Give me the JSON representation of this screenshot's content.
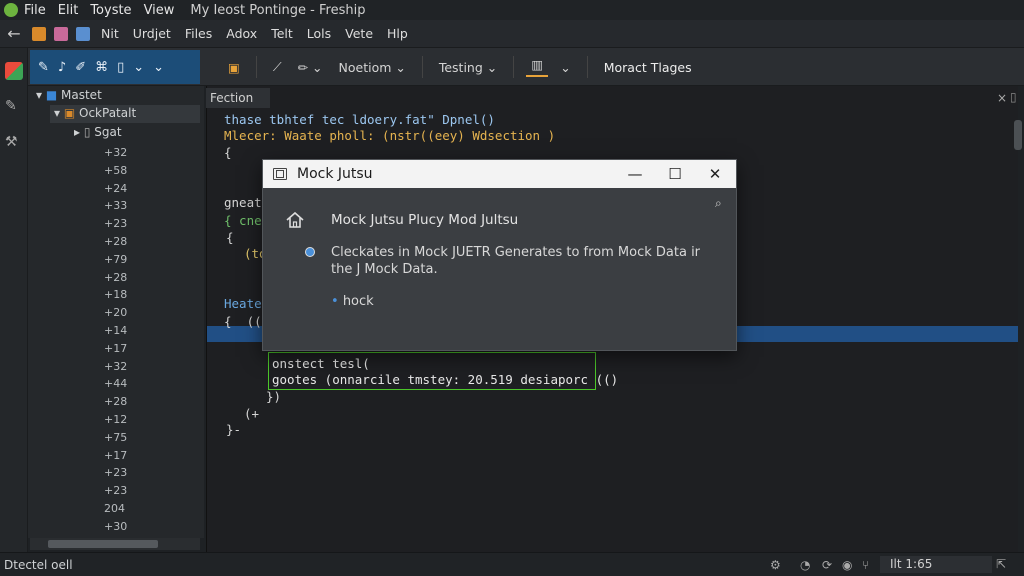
{
  "menubar": {
    "items": [
      "File",
      "Elit",
      "Toyste",
      "View"
    ],
    "title": "My Ieost  Pontinge - Freship"
  },
  "toolbar1": {
    "items": [
      "Nit",
      "Urdjet",
      "Files",
      "Adox",
      "Telt",
      "Lols",
      "Vete",
      "Hlp"
    ]
  },
  "toolbar2": {
    "nav_dropdown": "Noetiom",
    "testing_dropdown": "Testing",
    "tests_label": "Moract Tlages"
  },
  "project_tree": {
    "root": "Mastet",
    "child": "OckPatalt",
    "grandchild": "Sgat",
    "line_numbers": [
      "+32",
      "+58",
      "+24",
      "+33",
      "+23",
      "+28",
      "+79",
      "+28",
      "+18",
      "+20",
      "+14",
      "+17",
      "+32",
      "+44",
      "+28",
      "+12",
      "+75",
      "+17",
      "+23",
      "+23",
      "204",
      "+30"
    ]
  },
  "editor": {
    "tab_label": "Fection",
    "lines": [
      {
        "text": "thase tbhtef tec ldoery.fat\" Dpnel()"
      },
      {
        "text": "Mlecer: Waate pholl: (nstr((eey) Wdsection )"
      },
      {
        "text": "{"
      },
      {
        "text": "gneat"
      },
      {
        "text": "{ cnec"
      },
      {
        "text": "{"
      },
      {
        "text": "(toc"
      },
      {
        "text": "Heate"
      },
      {
        "text": "{  (("
      },
      {
        "text": "onstect tesl("
      },
      {
        "text": "gootes (onnarcile tmstey: 20.519 desiaporc (()"
      },
      {
        "text": "})"
      },
      {
        "text": "(+"
      },
      {
        "text": "}-"
      }
    ]
  },
  "dialog": {
    "title": "Mock Jutsu",
    "heading": "Mock Jutsu Plucy Mod Jultsu",
    "description": "Cleckates in Mock JUETR Generates to from Mock Data ir the J Mock Data.",
    "bullet": "hock",
    "colors": {
      "titlebar": "#f3f3f3",
      "body": "#3b3e42"
    }
  },
  "statusbar": {
    "left_text": "Dtectel oell",
    "cursor": "Ilt 1:65"
  },
  "colors": {
    "accent_blue": "#1c4d78",
    "highlight_line": "#214f85",
    "selection_box": "#4cc72a"
  }
}
